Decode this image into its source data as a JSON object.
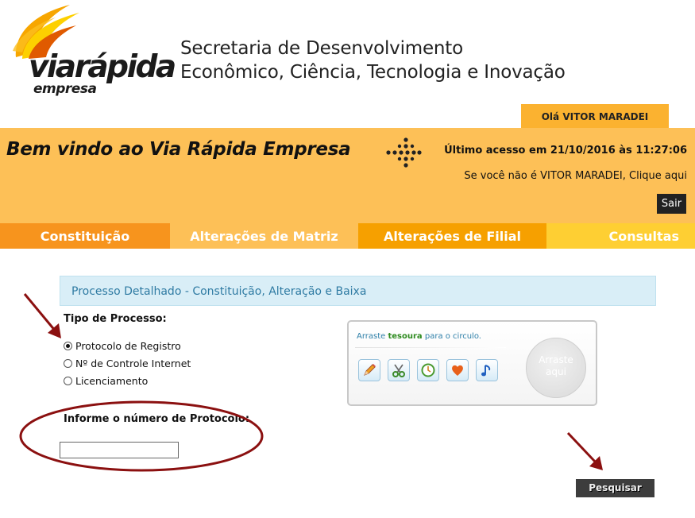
{
  "brand": {
    "logo_word": "viarápida",
    "logo_subtitle": "empresa",
    "logo_colors": [
      "#f7a600",
      "#fdd000",
      "#e05a00"
    ]
  },
  "header": {
    "title_line1": "Secretaria de Desenvolvimento",
    "title_line2": "Econômico, Ciência, Tecnologia e Inovação"
  },
  "user": {
    "greeting": "Olá VITOR MARADEI",
    "last_access": "Último acesso em 21/10/2016 às 11:27:06",
    "not_you": "Se você não é VITOR MARADEI, Clique aqui",
    "logout_label": "Sair"
  },
  "banner": {
    "welcome": "Bem vindo ao Via Rápida Empresa"
  },
  "nav": {
    "items": [
      {
        "label": "Constituição",
        "color": "#f7941d"
      },
      {
        "label": "Alterações de Matriz",
        "color": "#fdc057"
      },
      {
        "label": "Alterações de Filial",
        "color": "#f6a000"
      },
      {
        "label": "Consultas",
        "color": "#fecf33"
      }
    ]
  },
  "main": {
    "section_title": "Processo Detalhado - Constituição, Alteração e Baixa",
    "process_type_label": "Tipo de Processo:",
    "process_options": [
      {
        "label": "Protocolo de Registro",
        "selected": true
      },
      {
        "label": "Nº de Controle Internet",
        "selected": false
      },
      {
        "label": "Licenciamento",
        "selected": false
      }
    ],
    "protocol_label": "Informe o número de Protocolo:",
    "protocol_value": "",
    "search_label": "Pesquisar"
  },
  "captcha": {
    "instruction_prefix": "Arraste ",
    "instruction_highlight": "tesoura",
    "instruction_suffix": " para o circulo.",
    "icons": [
      "pencil-icon",
      "scissors-icon",
      "clock-icon",
      "heart-icon",
      "music-note-icon"
    ],
    "target_line1": "Arraste",
    "target_line2": "aqui"
  },
  "annotations": {
    "color": "#8b1010"
  }
}
